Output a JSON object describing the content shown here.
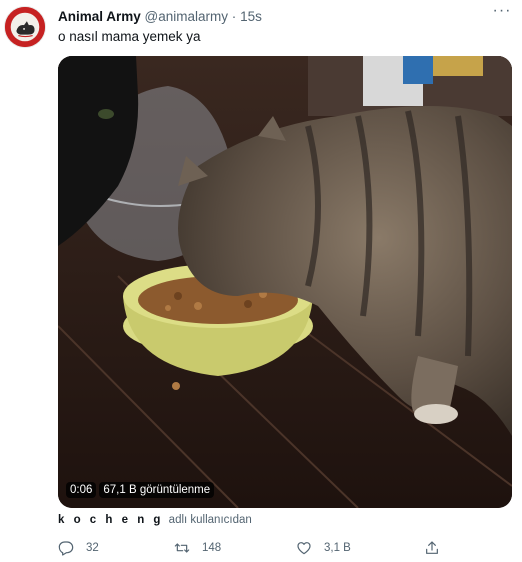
{
  "tweet": {
    "author_name": "Animal Army",
    "author_handle": "@animalarmy",
    "separator": "·",
    "time": "15s",
    "text": "o nasıl mama yemek ya",
    "more_label": "···"
  },
  "media": {
    "duration": "0:06",
    "views": "67,1 B görüntülenme"
  },
  "attribution": {
    "user": "k o c h e n g",
    "suffix": "adlı kullanıcıdan"
  },
  "actions": {
    "reply_count": "32",
    "retweet_count": "148",
    "like_count": "3,1 B"
  },
  "icons": {
    "reply": "reply-icon",
    "retweet": "retweet-icon",
    "like": "heart-icon",
    "share": "share-icon",
    "more": "more-icon"
  },
  "colors": {
    "text": "#0f1419",
    "secondary": "#536471",
    "avatar_bg": "#c62222"
  }
}
